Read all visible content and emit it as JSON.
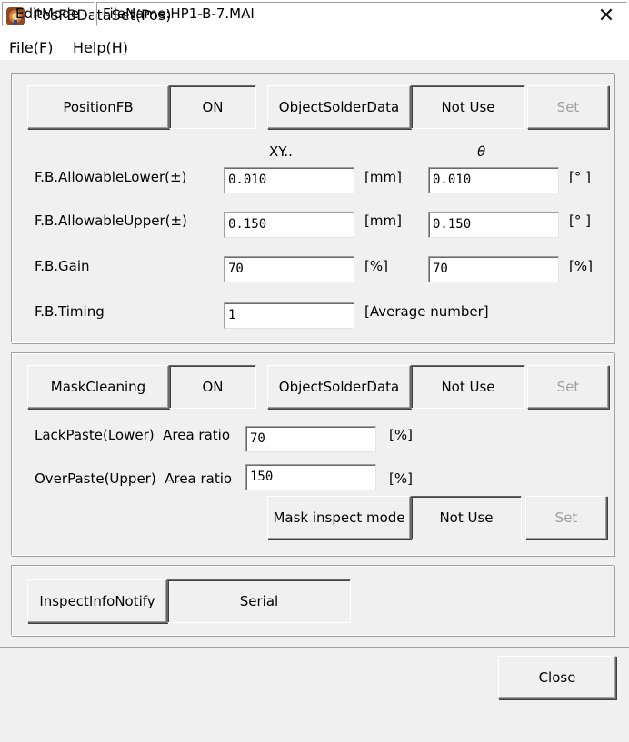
{
  "window": {
    "title": "PosFBDataSet(Pos)",
    "close_glyph": "✕"
  },
  "menu": [
    {
      "label": "File(F)"
    },
    {
      "label": "Help(H)"
    }
  ],
  "position_fb": {
    "button_label": "PositionFB",
    "state": "ON",
    "object_label": "ObjectSolderData",
    "object_value": "Not Use",
    "set_label": "Set",
    "col_xy": "XY..",
    "col_theta": "θ",
    "rows": [
      {
        "label": "F.B.AllowableLower(±)",
        "xy": "0.010",
        "xy_unit": "[mm]",
        "theta": "0.010",
        "theta_unit": "[° ]"
      },
      {
        "label": "F.B.AllowableUpper(±)",
        "xy": "0.150",
        "xy_unit": "[mm]",
        "theta": "0.150",
        "theta_unit": "[° ]"
      },
      {
        "label": "F.B.Gain",
        "xy": "70",
        "xy_unit": "[%]",
        "theta": "70",
        "theta_unit": "[%]"
      }
    ],
    "timing_label": "F.B.Timing",
    "timing_value": "1",
    "timing_unit": "[Average number]"
  },
  "mask_cleaning": {
    "button_label": "MaskCleaning",
    "state": "ON",
    "object_label": "ObjectSolderData",
    "object_value": "Not Use",
    "set_label": "Set",
    "lack_label": "LackPaste(Lower)  Area ratio",
    "lack_value": "70",
    "lack_unit": "[%]",
    "over_label": "OverPaste(Upper)  Area ratio",
    "over_value": "150",
    "over_unit": "[%]",
    "inspect_mode_label": "Mask inspect mode",
    "inspect_mode_value": "Not Use",
    "inspect_set_label": "Set"
  },
  "inspect_info": {
    "button_label": "InspectInfoNotify",
    "value": "Serial"
  },
  "footer": {
    "close_label": "Close"
  },
  "status": {
    "mode": "EditMode",
    "filename": "FileName:HP1-B-7.MAI"
  },
  "colors": {
    "titlebar_bg": "#ffffff",
    "window_bg": "#f0f0f0",
    "disabled_text": "#a0a0a0"
  }
}
